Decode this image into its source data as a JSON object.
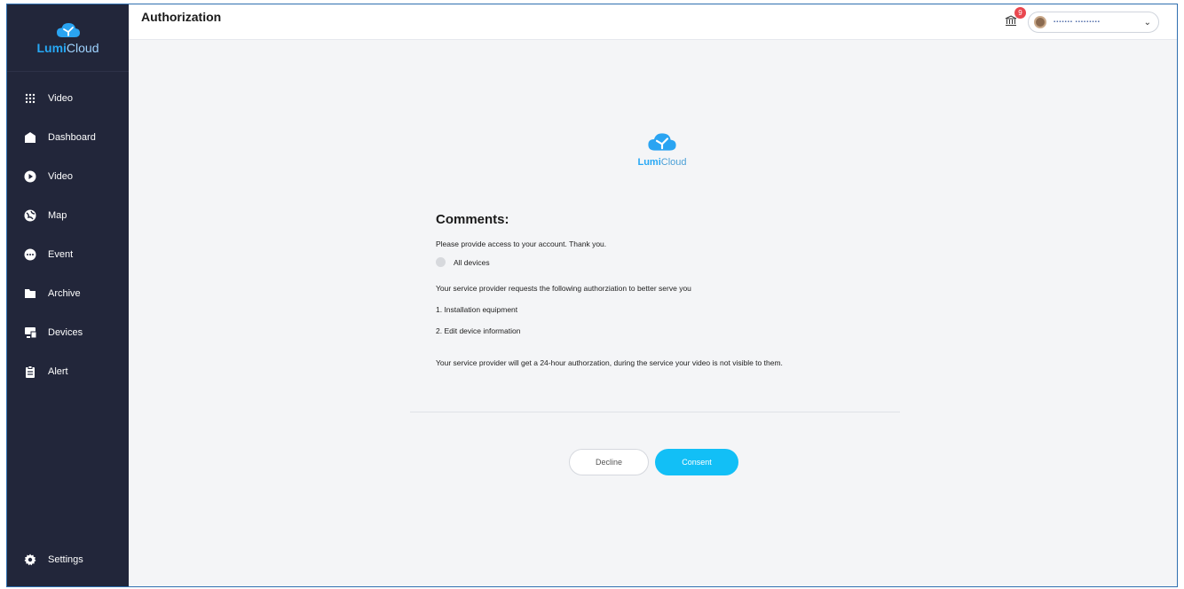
{
  "brand": {
    "name_bold": "Lumi",
    "name_rest": "Cloud"
  },
  "sidebar": {
    "items": [
      {
        "label": "Video",
        "icon": "grid-icon"
      },
      {
        "label": "Dashboard",
        "icon": "home-icon"
      },
      {
        "label": "Video",
        "icon": "play-icon"
      },
      {
        "label": "Map",
        "icon": "map-icon"
      },
      {
        "label": "Event",
        "icon": "chat-icon"
      },
      {
        "label": "Archive",
        "icon": "folder-icon"
      },
      {
        "label": "Devices",
        "icon": "devices-icon"
      },
      {
        "label": "Alert",
        "icon": "clipboard-icon"
      }
    ],
    "settings_label": "Settings"
  },
  "header": {
    "title": "Authorization",
    "notification_count": "9",
    "user_name": "▪▪▪▪▪▪▪ ▪▪▪▪▪▪▪▪▪"
  },
  "main": {
    "comments_title": "Comments:",
    "request_text": "Please provide access to your account. Thank you.",
    "devices_option": "All devices",
    "provider_request": "Your service provider requests the following authorziation to better serve you",
    "permissions": [
      "1. Installation equipment",
      "2. Edit device information"
    ],
    "notice": "Your service provider will get a 24-hour authorzation, during the service your video is not visible to them.",
    "decline_label": "Decline",
    "consent_label": "Consent"
  },
  "colors": {
    "sidebar_bg": "#22263a",
    "accent": "#12bff6",
    "brand_blue": "#27a8f5",
    "badge_red": "#e9474f"
  }
}
